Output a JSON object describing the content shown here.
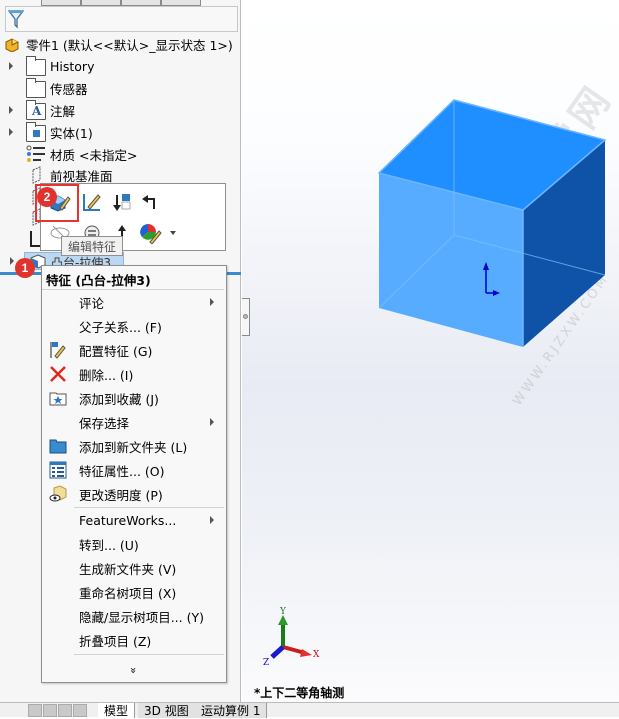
{
  "tree": {
    "root": "零件1  (默认<<默认>_显示状态 1>)",
    "items": [
      {
        "label": "History",
        "expandable": true
      },
      {
        "label": "传感器",
        "expandable": false
      },
      {
        "label": "注解",
        "expandable": true
      },
      {
        "label": "实体(1)",
        "expandable": true
      },
      {
        "label": "材质 <未指定>",
        "expandable": false
      },
      {
        "label": "前视基准面",
        "expandable": false
      }
    ],
    "selected": "凸台-拉伸3"
  },
  "toolbar": {
    "tooltip": "编辑特征",
    "buttons": [
      "edit-feature",
      "edit-sketch",
      "rollback",
      "parent",
      "hide",
      "suppress",
      "move-up",
      "appearance"
    ]
  },
  "badges": {
    "one": "1",
    "two": "2"
  },
  "context_menu": {
    "title": "特征 (凸台-拉伸3)",
    "items": [
      {
        "label": "评论",
        "submenu": true
      },
      {
        "label": "父子关系... (F)"
      },
      {
        "label": "配置特征 (G)",
        "icon": "configure-feature-icon"
      },
      {
        "label": "删除... (I)",
        "icon": "delete-icon"
      },
      {
        "label": "添加到收藏 (J)",
        "icon": "favorite-folder-icon"
      },
      {
        "label": "保存选择",
        "submenu": true
      },
      {
        "label": "添加到新文件夹 (L)",
        "icon": "folder-icon"
      },
      {
        "label": "特征属性... (O)",
        "icon": "properties-icon"
      },
      {
        "label": "更改透明度 (P)",
        "icon": "transparency-icon"
      },
      {
        "label": "FeatureWorks...",
        "submenu": true
      },
      {
        "label": "转到... (U)"
      },
      {
        "label": "生成新文件夹 (V)"
      },
      {
        "label": "重命名树项目 (X)"
      },
      {
        "label": "隐藏/显示树项目... (Y)"
      },
      {
        "label": "折叠项目 (Z)"
      }
    ],
    "more": "»"
  },
  "viewport": {
    "view_name": "*上下二等角轴测",
    "triad": {
      "x": "X",
      "y": "Y",
      "z": "Z"
    },
    "watermark": "软件自学网",
    "watermark_url": "WWW.RJZXW.COM",
    "cube_colors": {
      "top": "#1f8fff",
      "front": "#57acff",
      "side": "#0f53a8"
    }
  },
  "bottom_tabs": [
    "模型",
    "3D 视图",
    "运动算例 1"
  ]
}
